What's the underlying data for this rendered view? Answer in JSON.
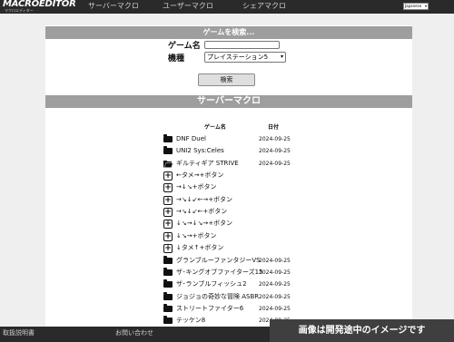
{
  "header": {
    "logo_text": "MACROEDITOR",
    "logo_sub": "マクロエディター",
    "nav": [
      "サーバーマクロ",
      "ユーザーマクロ",
      "シェアマクロ"
    ],
    "language": "Japanese"
  },
  "search": {
    "title": "ゲームを検索...",
    "game_name_label": "ゲーム名",
    "game_name_value": "",
    "platform_label": "機種",
    "platform_value": "プレイステーション5",
    "button_label": "検索"
  },
  "server_macros": {
    "title": "サーバーマクロ",
    "columns": {
      "name": "ゲーム名",
      "date": "日付"
    },
    "rows": [
      {
        "type": "folder",
        "name": "DNF Duel",
        "date": "2024-09-25"
      },
      {
        "type": "folder",
        "name": "UNI2 Sys:Celes",
        "date": "2024-09-25"
      },
      {
        "type": "folder-open",
        "name": "ギルティギア STRIVE",
        "date": "2024-09-25"
      },
      {
        "type": "macro",
        "name": "←タメ→+ボタン",
        "date": ""
      },
      {
        "type": "macro",
        "name": "→↓↘+ボタン",
        "date": ""
      },
      {
        "type": "macro",
        "name": "→↘↓↙←→+ボタン",
        "date": ""
      },
      {
        "type": "macro",
        "name": "→↘↓↙←+ボタン",
        "date": ""
      },
      {
        "type": "macro",
        "name": "↓↘→↓↘→+ボタン",
        "date": ""
      },
      {
        "type": "macro",
        "name": "↓↘→+ボタン",
        "date": ""
      },
      {
        "type": "macro",
        "name": "↓タメ↑+ボタン",
        "date": ""
      },
      {
        "type": "folder",
        "name": "グランブルーファンタジーVS",
        "date": "2024-09-25"
      },
      {
        "type": "folder",
        "name": "ザ･キングオブファイターズ15",
        "date": "2024-09-25"
      },
      {
        "type": "folder",
        "name": "ザ･ランブルフィッシュ2",
        "date": "2024-09-25"
      },
      {
        "type": "folder",
        "name": "ジョジョの奇妙な冒険 ASBR",
        "date": "2024-09-25"
      },
      {
        "type": "folder",
        "name": "ストリートファイター6",
        "date": "2024-09-25"
      },
      {
        "type": "folder",
        "name": "テッケン8",
        "date": "2024-09-25"
      }
    ]
  },
  "footer": {
    "manual_link": "取扱説明書",
    "contact_link": "お問い合わせ",
    "dev_notice": "画像は開発途中のイメージです"
  }
}
